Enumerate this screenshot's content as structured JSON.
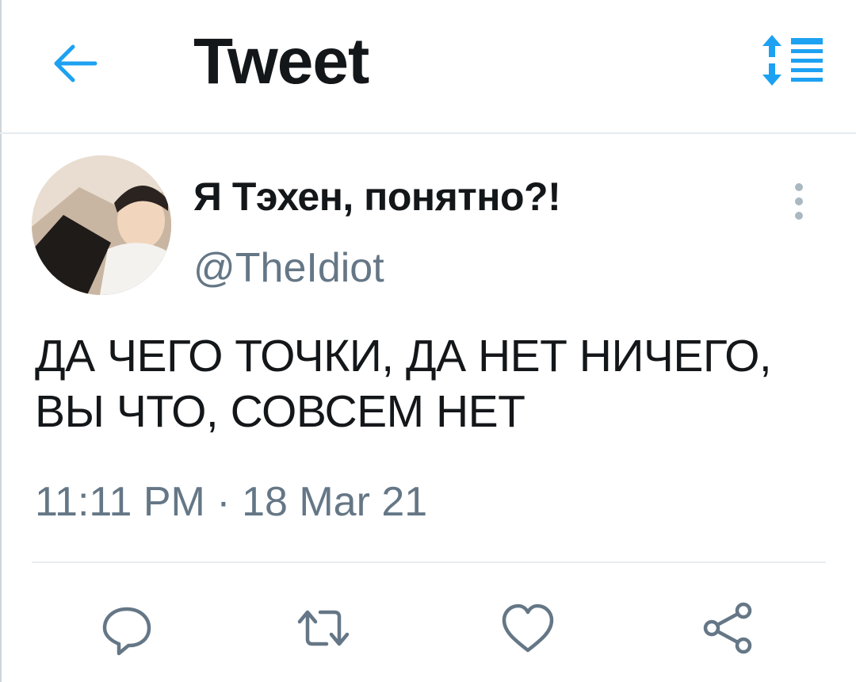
{
  "header": {
    "title": "Tweet",
    "back_icon": "arrow-left-icon",
    "sort_icon": "sort-order-icon"
  },
  "tweet": {
    "author": {
      "display_name": "Я Тэхен, понятно?!",
      "handle": "@TheIdiot",
      "avatar_icon": "avatar-photo"
    },
    "text_lines": [
      "ДА ЧЕГО ТОЧКИ, ДА НЕТ НИЧЕГО,",
      "ВЫ ЧТО, СОВСЕМ НЕТ"
    ],
    "timestamp": "11:11 PM · 18 Mar 21"
  },
  "actions": {
    "reply_icon": "reply-icon",
    "retweet_icon": "retweet-icon",
    "like_icon": "heart-icon",
    "share_icon": "share-icon"
  },
  "colors": {
    "accent": "#1da1f2",
    "text": "#14171a",
    "muted": "#657786",
    "divider": "#e6ecf0"
  }
}
